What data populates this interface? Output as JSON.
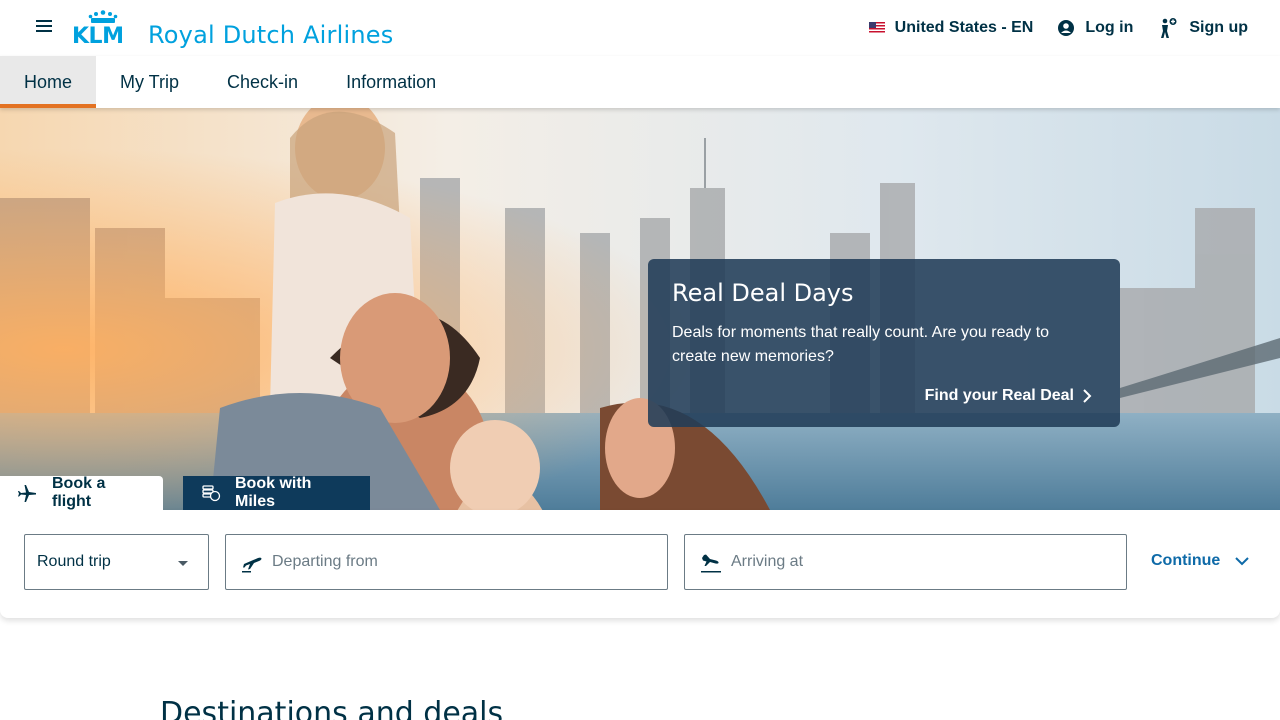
{
  "header": {
    "logo_text": "KLM",
    "brand_name": "Royal Dutch Airlines",
    "locale_label": "United States - EN",
    "login_label": "Log in",
    "signup_label": "Sign up"
  },
  "nav": {
    "tabs": [
      {
        "label": "Home",
        "active": true
      },
      {
        "label": "My Trip"
      },
      {
        "label": "Check-in"
      },
      {
        "label": "Information"
      }
    ]
  },
  "hero": {
    "deal_title": "Real Deal Days",
    "deal_text": "Deals for moments that really count. Are you ready to create new memories?",
    "deal_link": "Find your Real Deal"
  },
  "booking": {
    "tabs": [
      {
        "label": "Book a flight",
        "icon": "airplane-icon",
        "active": true
      },
      {
        "label": "Book with Miles",
        "icon": "miles-coins-icon"
      }
    ],
    "trip_type": "Round trip",
    "departing_placeholder": "Departing from",
    "arriving_placeholder": "Arriving at",
    "continue_label": "Continue"
  },
  "sections": {
    "destinations_title": "Destinations and deals"
  },
  "colors": {
    "brand_blue": "#00a1de",
    "dark_text": "#003145",
    "accent_orange": "#e37222",
    "link_blue": "#0e6aa8",
    "deal_card_bg": "#213c58",
    "miles_tab_bg": "#0e3a5b"
  }
}
